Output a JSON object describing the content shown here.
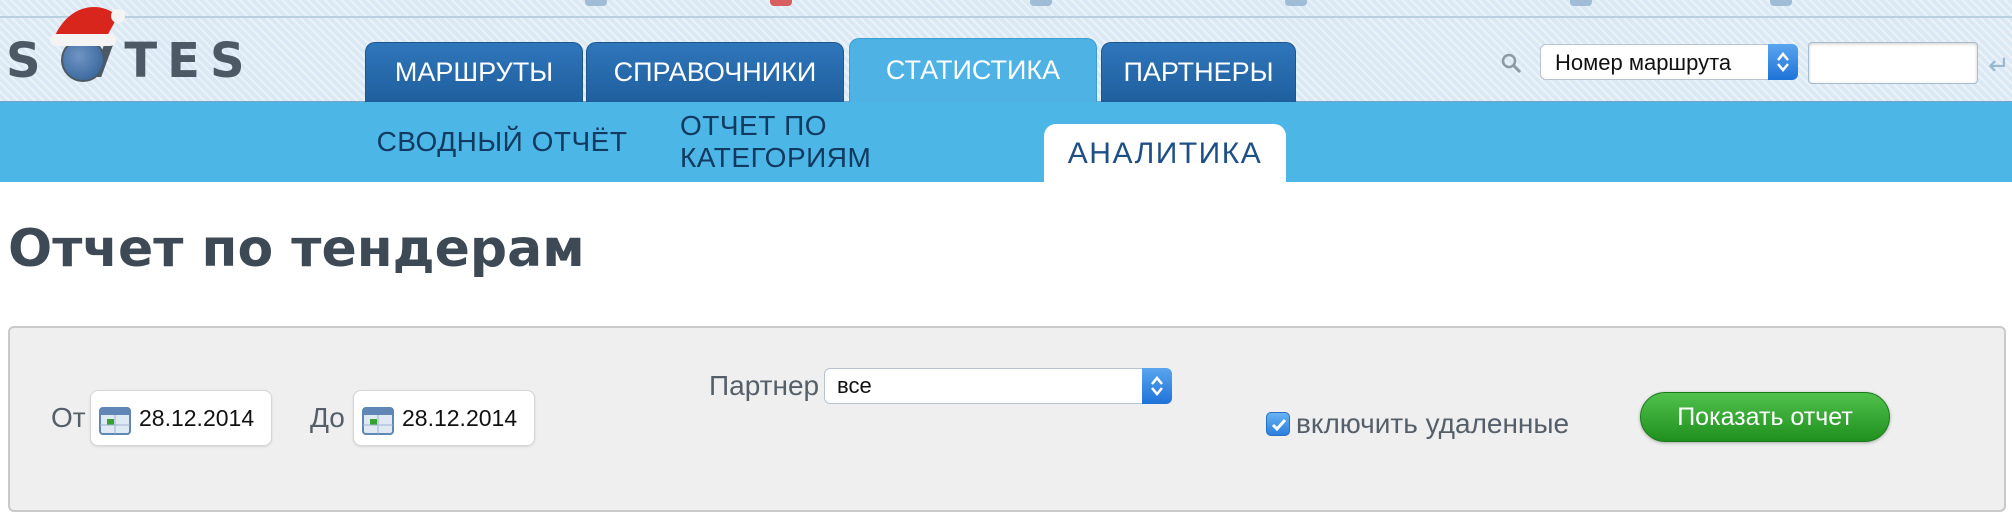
{
  "header": {
    "logo_text": "S VTES",
    "main_tabs": [
      {
        "label": "МАРШРУТЫ"
      },
      {
        "label": "СПРАВОЧНИКИ"
      },
      {
        "label": "СТАТИСТИКА"
      },
      {
        "label": "ПАРТНЕРЫ"
      }
    ],
    "search": {
      "select_value": "Номер маршрута",
      "input_value": ""
    }
  },
  "subnav": {
    "tabs": [
      {
        "label": "СВОДНЫЙ ОТЧЁТ"
      },
      {
        "label": "ОТЧЕТ ПО КАТЕГОРИЯМ"
      },
      {
        "label": "АНАЛИТИКА"
      }
    ]
  },
  "page": {
    "title": "Отчет по тендерам"
  },
  "filters": {
    "from_label": "От",
    "from_date": "28.12.2014",
    "to_label": "До",
    "to_date": "28.12.2014",
    "partner_label": "Партнер",
    "partner_value": "все",
    "include_deleted_label": "включить удаленные",
    "include_deleted_checked": true,
    "show_button": "Показать отчет"
  },
  "colors": {
    "main_tab": "#1f5f9e",
    "active_tab": "#4fb2e4",
    "subnav": "#4cb6e6",
    "button_green": "#2a9a28"
  }
}
